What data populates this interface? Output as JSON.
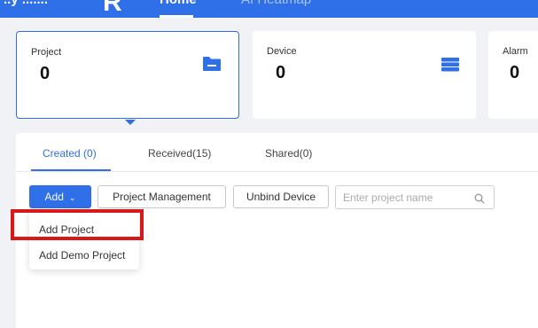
{
  "header": {
    "brand_text": "..y .......",
    "brand_logo": "R",
    "nav": [
      {
        "label": "Home",
        "active": true
      },
      {
        "label": "AI Heatmap",
        "active": false
      }
    ],
    "color": "#2f6fe8"
  },
  "stats": [
    {
      "label": "Project",
      "value": "0",
      "icon": "folder-icon",
      "selected": true
    },
    {
      "label": "Device",
      "value": "0",
      "icon": "device-stack-icon",
      "selected": false
    },
    {
      "label": "Alarm",
      "value": "0",
      "icon": "",
      "selected": false
    }
  ],
  "tabs": [
    {
      "label": "Created (0)",
      "active": true
    },
    {
      "label": "Received(15)",
      "active": false
    },
    {
      "label": "Shared(0)",
      "active": false
    }
  ],
  "toolbar": {
    "add_label": "Add",
    "project_management_label": "Project Management",
    "unbind_device_label": "Unbind Device",
    "search_placeholder": "Enter project name"
  },
  "add_menu": {
    "items": [
      "Add Project",
      "Add Demo Project"
    ],
    "highlighted_index": 0,
    "highlight_color": "#d7191c"
  }
}
